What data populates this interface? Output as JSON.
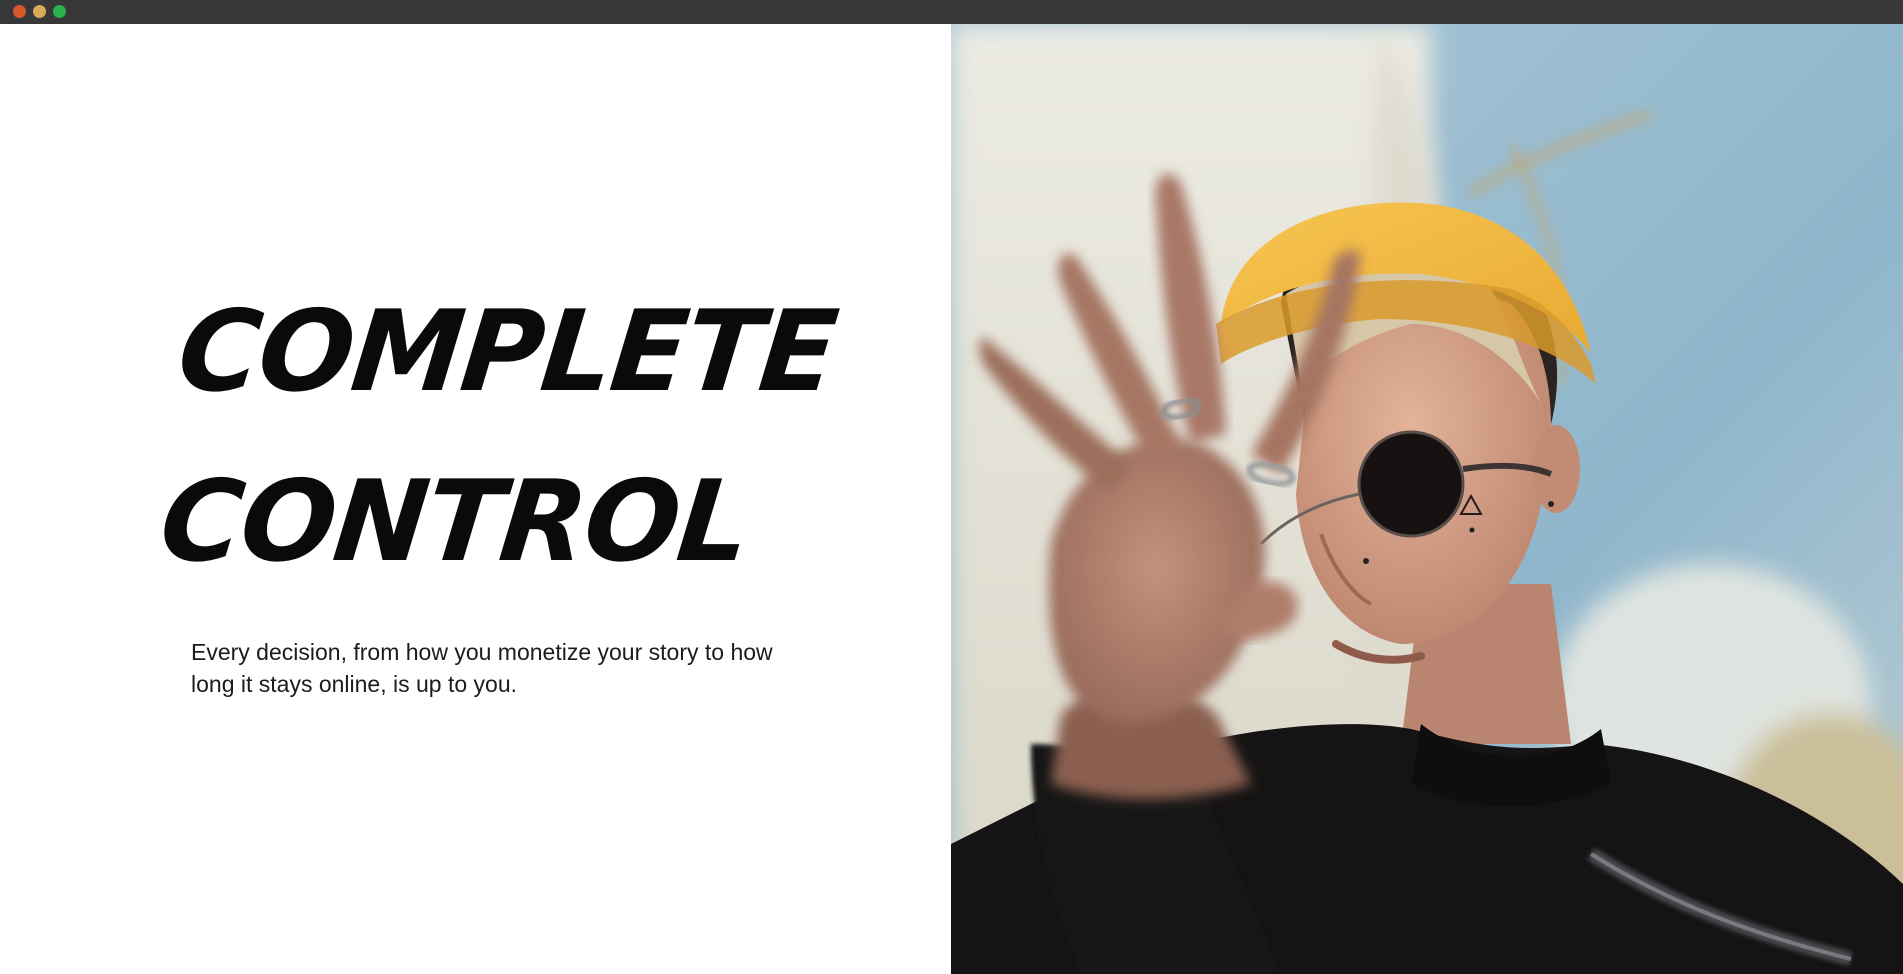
{
  "window": {
    "controls": [
      "close",
      "minimize",
      "maximize"
    ]
  },
  "hero": {
    "headline_line1": "COMPLETE",
    "headline_line2": "CONTROL",
    "body": "Every decision, from how you monetize your story to how long it stays online, is up to you."
  },
  "photo": {
    "subject": "person-with-yellow-beanie-and-round-sunglasses-reaching-hand-toward-camera",
    "colors": {
      "sky": "#9cc0d4",
      "wall": "#e8e6dc",
      "beanie": "#f2b73e",
      "skin": "#c99378",
      "sweater": "#141212",
      "hair": "#d8c8a8"
    }
  },
  "colors": {
    "titlebar": "#38383b",
    "close": "#d8582c",
    "minimize": "#d9a95a",
    "maximize": "#28b24b",
    "headline": "#0a0a0a",
    "body_text": "#1c1c1c",
    "background": "#ffffff"
  }
}
